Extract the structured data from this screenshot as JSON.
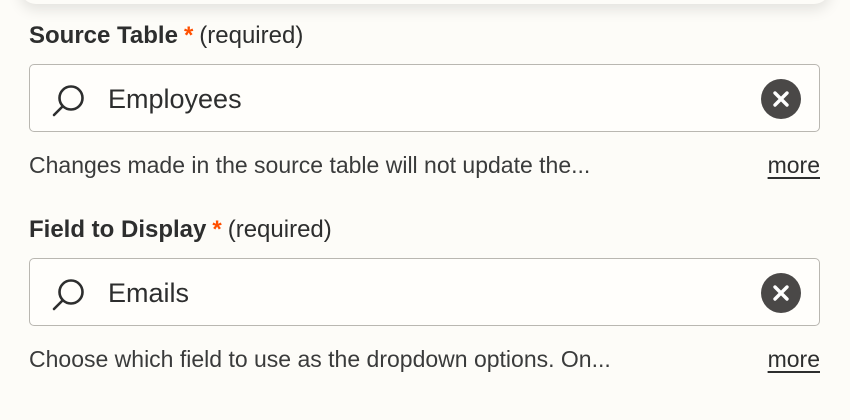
{
  "source_table": {
    "label": "Source Table",
    "required_star": "*",
    "required_text": "(required)",
    "value": "Employees",
    "help_text": "Changes made in the source table will not update the...",
    "more_label": "more"
  },
  "field_to_display": {
    "label": "Field to Display",
    "required_star": "*",
    "required_text": "(required)",
    "value": "Emails",
    "help_text": "Choose which field to use as the dropdown options. On...",
    "more_label": "more"
  },
  "icons": {
    "search": "search-icon",
    "clear": "clear-icon"
  },
  "colors": {
    "required_star": "#ff4f00",
    "text": "#2d2e2e",
    "border": "#b9b7b1",
    "clear_button": "#4a4847",
    "background": "#fdfcf8"
  }
}
